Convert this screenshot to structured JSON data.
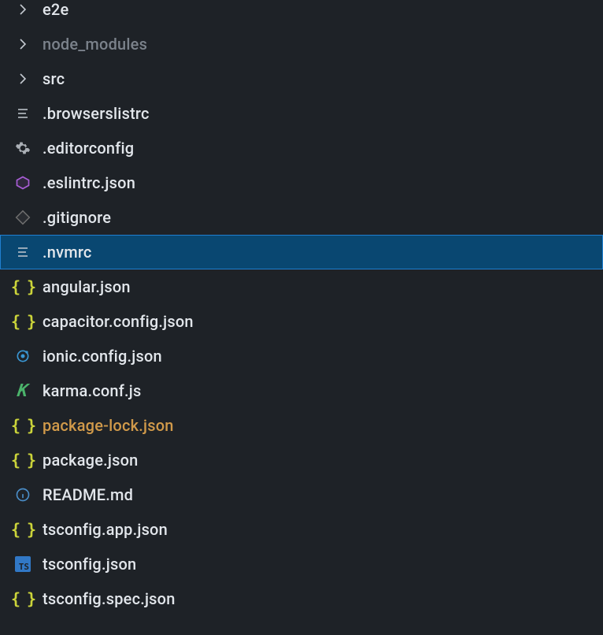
{
  "explorer": {
    "items": [
      {
        "name": "e2e",
        "type": "folder",
        "icon": "chevron",
        "state": "cut"
      },
      {
        "name": "node_modules",
        "type": "folder",
        "icon": "chevron",
        "state": "dim"
      },
      {
        "name": "src",
        "type": "folder",
        "icon": "chevron",
        "state": "normal"
      },
      {
        "name": ".browserslistrc",
        "type": "file",
        "icon": "text",
        "state": "normal"
      },
      {
        "name": ".editorconfig",
        "type": "file",
        "icon": "gear",
        "state": "normal"
      },
      {
        "name": ".eslintrc.json",
        "type": "file",
        "icon": "eslint",
        "state": "normal"
      },
      {
        "name": ".gitignore",
        "type": "file",
        "icon": "git",
        "state": "normal"
      },
      {
        "name": ".nvmrc",
        "type": "file",
        "icon": "text",
        "state": "selected"
      },
      {
        "name": "angular.json",
        "type": "file",
        "icon": "braces",
        "state": "normal"
      },
      {
        "name": "capacitor.config.json",
        "type": "file",
        "icon": "braces",
        "state": "normal"
      },
      {
        "name": "ionic.config.json",
        "type": "file",
        "icon": "ionic",
        "state": "normal"
      },
      {
        "name": "karma.conf.js",
        "type": "file",
        "icon": "karma",
        "state": "normal"
      },
      {
        "name": "package-lock.json",
        "type": "file",
        "icon": "braces",
        "state": "modified"
      },
      {
        "name": "package.json",
        "type": "file",
        "icon": "braces",
        "state": "normal"
      },
      {
        "name": "README.md",
        "type": "file",
        "icon": "info",
        "state": "normal"
      },
      {
        "name": "tsconfig.app.json",
        "type": "file",
        "icon": "braces",
        "state": "normal"
      },
      {
        "name": "tsconfig.json",
        "type": "file",
        "icon": "ts",
        "state": "normal"
      },
      {
        "name": "tsconfig.spec.json",
        "type": "file",
        "icon": "braces",
        "state": "normal"
      }
    ]
  },
  "icons": {
    "ts_badge": "TS",
    "karma_letter": "K",
    "braces": "{ }"
  }
}
